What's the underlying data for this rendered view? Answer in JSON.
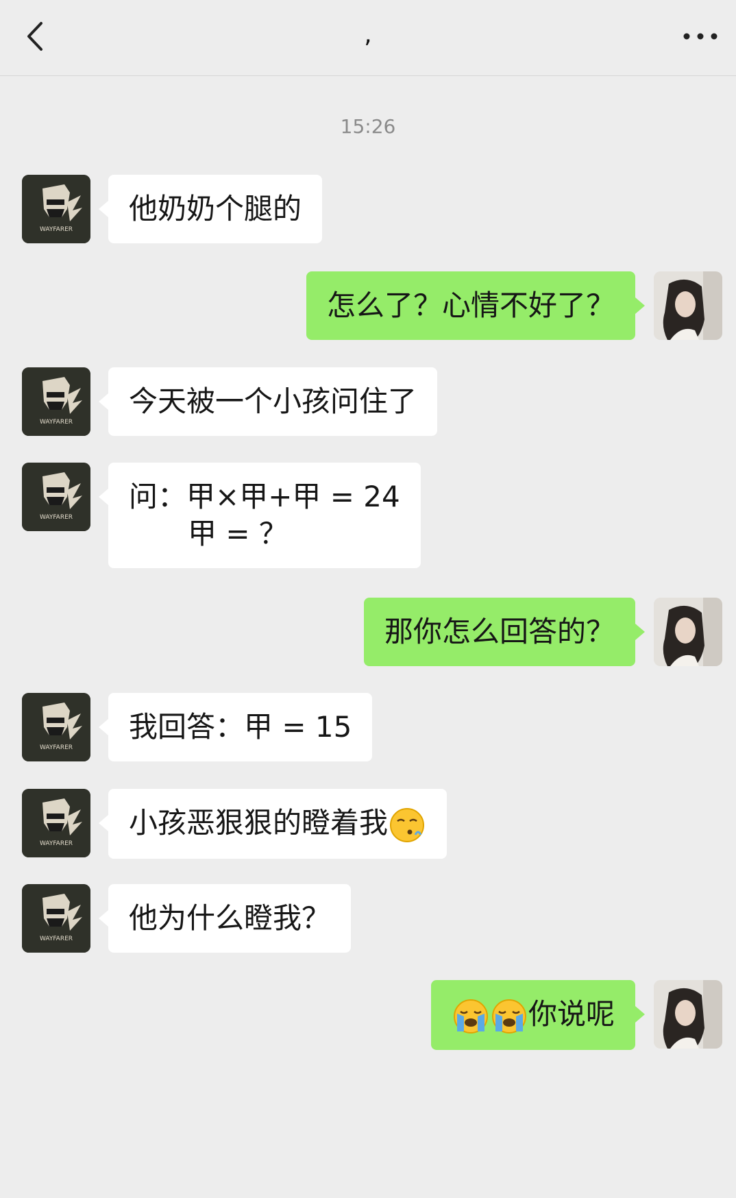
{
  "header": {
    "title": ","
  },
  "timestamp": "15:26",
  "messages": [
    {
      "side": "left",
      "lines": [
        "他奶奶个腿的"
      ]
    },
    {
      "side": "right",
      "lines": [
        "怎么了？心情不好了？"
      ]
    },
    {
      "side": "left",
      "lines": [
        "今天被一个小孩问住了"
      ]
    },
    {
      "side": "left",
      "lines": [
        "问：甲×甲+甲 = 24",
        "甲 = ？"
      ]
    },
    {
      "side": "right",
      "lines": [
        "那你怎么回答的？"
      ]
    },
    {
      "side": "left",
      "lines": [
        "我回答：甲 = 15"
      ]
    },
    {
      "side": "left",
      "lines": [
        "小孩恶狠狠的瞪着我"
      ],
      "trailing_emoji": "kissing-face-emoji"
    },
    {
      "side": "left",
      "lines": [
        "他为什么瞪我？"
      ]
    },
    {
      "side": "right",
      "lines": [
        "你说呢"
      ],
      "leading_emojis": [
        "loudly-crying-face-emoji",
        "loudly-crying-face-emoji"
      ]
    }
  ],
  "avatars": {
    "left_badge": "WAYFARER"
  },
  "colors": {
    "background": "#ededed",
    "incoming_bubble": "#ffffff",
    "outgoing_bubble": "#95ec69"
  }
}
